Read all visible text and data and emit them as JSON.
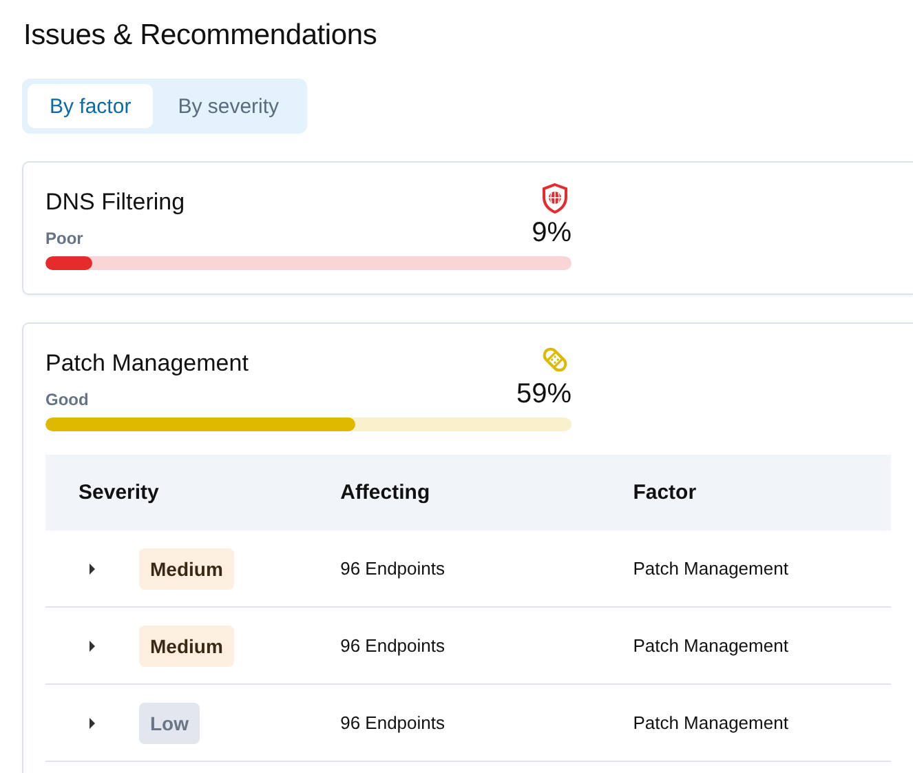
{
  "title": "Issues & Recommendations",
  "tabs": [
    {
      "label": "By factor",
      "selected": true
    },
    {
      "label": "By severity",
      "selected": false
    }
  ],
  "factors": [
    {
      "name": "DNS Filtering",
      "kind": "shield",
      "rating": "Poor",
      "percent": "9%",
      "level": 0.09,
      "color": "#e52b2b"
    },
    {
      "name": "Patch Management",
      "kind": "bandage",
      "rating": "Good",
      "percent": "59%",
      "level": 0.59,
      "color": "#dfb800",
      "table": {
        "columns": [
          "Severity",
          "Affecting",
          "Factor"
        ],
        "rows": [
          {
            "expanded": false,
            "severity": "Medium",
            "kind": "medium",
            "affecting": "96 Endpoints",
            "factor": "Patch Management"
          },
          {
            "expanded": false,
            "severity": "Medium",
            "kind": "medium",
            "affecting": "96 Endpoints",
            "factor": "Patch Management"
          },
          {
            "expanded": false,
            "severity": "Low",
            "kind": "low",
            "affecting": "96 Endpoints",
            "factor": "Patch Management"
          }
        ]
      }
    }
  ]
}
